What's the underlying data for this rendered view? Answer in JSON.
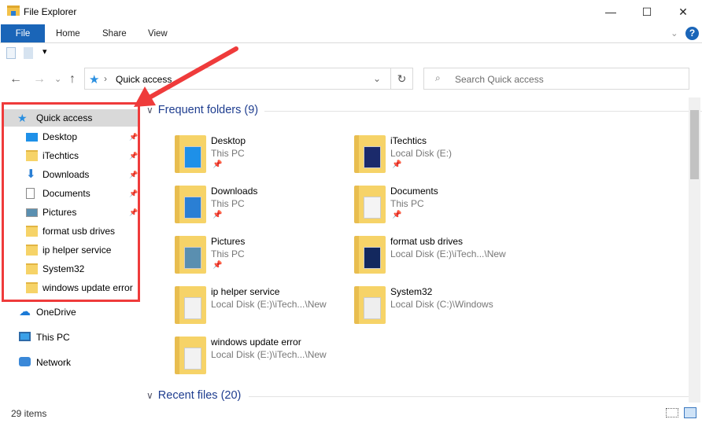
{
  "window": {
    "title": "File Explorer",
    "minimize": "—",
    "maximize": "☐",
    "close": "✕"
  },
  "ribbon": {
    "tabs": [
      "File",
      "Home",
      "Share",
      "View"
    ],
    "help": "?",
    "expand": "⌄"
  },
  "qat": {
    "dropdown": "▾"
  },
  "nav": {
    "back": "←",
    "forward": "→",
    "recent": "⌄",
    "up": "↑",
    "path": "Quick access",
    "sep": "›",
    "refresh": "↻",
    "dropdown": "⌄",
    "search_placeholder": "Search Quick access"
  },
  "sidebar": {
    "items": [
      {
        "label": "Quick access",
        "icon": "star-icon",
        "pinned": false,
        "selected": true
      },
      {
        "label": "Desktop",
        "icon": "desktop-icon",
        "pinned": true
      },
      {
        "label": "iTechtics",
        "icon": "folder-icon",
        "pinned": true
      },
      {
        "label": "Downloads",
        "icon": "download-icon",
        "pinned": true
      },
      {
        "label": "Documents",
        "icon": "documents-icon",
        "pinned": true
      },
      {
        "label": "Pictures",
        "icon": "pictures-icon",
        "pinned": true
      },
      {
        "label": "format usb drives",
        "icon": "folder-icon",
        "pinned": false
      },
      {
        "label": "ip helper service",
        "icon": "folder-icon",
        "pinned": false
      },
      {
        "label": "System32",
        "icon": "folder-icon",
        "pinned": false
      },
      {
        "label": "windows update error",
        "icon": "folder-icon",
        "pinned": false
      }
    ],
    "roots": [
      {
        "label": "OneDrive",
        "icon": "cloud-icon"
      },
      {
        "label": "This PC",
        "icon": "computer-icon"
      },
      {
        "label": "Network",
        "icon": "network-icon"
      }
    ]
  },
  "content": {
    "frequent_header": "Frequent folders (9)",
    "recent_header": "Recent files (20)",
    "folders": [
      {
        "name": "Desktop",
        "location": "This PC",
        "pinned": true,
        "overlay": "#1e90e8"
      },
      {
        "name": "iTechtics",
        "location": "Local Disk (E:)",
        "pinned": true,
        "overlay": "#1b2a6b"
      },
      {
        "name": "Downloads",
        "location": "This PC",
        "pinned": true,
        "overlay": "#2a7fd4"
      },
      {
        "name": "Documents",
        "location": "This PC",
        "pinned": true,
        "overlay": "#f4f4f4"
      },
      {
        "name": "Pictures",
        "location": "This PC",
        "pinned": true,
        "overlay": "#5a8fb0"
      },
      {
        "name": "format usb drives",
        "location": "Local Disk (E:)\\iTech...\\New",
        "pinned": false,
        "overlay": "#13285e"
      },
      {
        "name": "ip helper service",
        "location": "Local Disk (E:)\\iTech...\\New",
        "pinned": false,
        "overlay": "#f2f2f2"
      },
      {
        "name": "System32",
        "location": "Local Disk (C:)\\Windows",
        "pinned": false,
        "overlay": "#eeeeee"
      },
      {
        "name": "windows update error",
        "location": "Local Disk (E:)\\iTech...\\New",
        "pinned": false,
        "overlay": "#f2f2f2"
      }
    ]
  },
  "status": {
    "count": "29 items"
  },
  "colors": {
    "accent": "#1a65b8",
    "highlight": "#ef3b3b",
    "selected": "#cce8ff"
  }
}
